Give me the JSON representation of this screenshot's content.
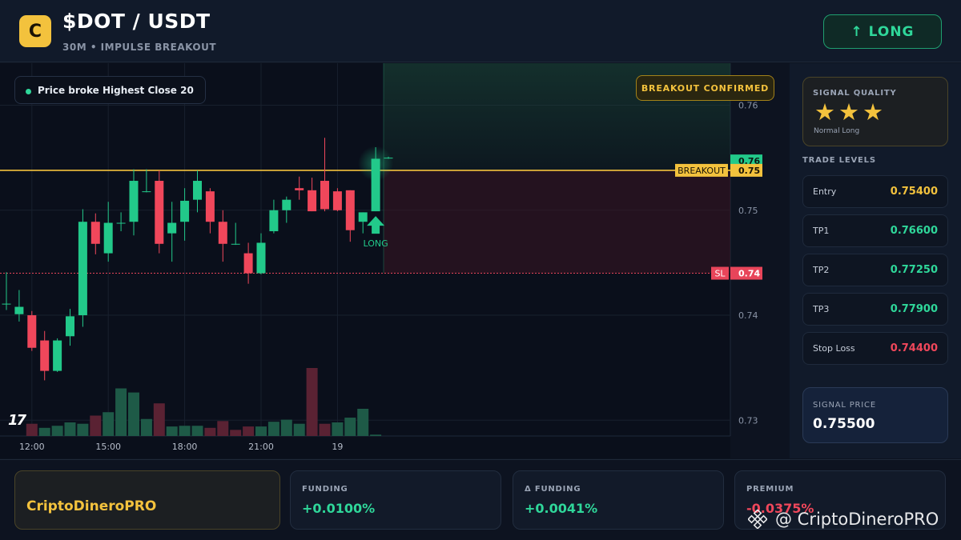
{
  "header": {
    "logo_letter": "C",
    "title": "$DOT / USDT",
    "subtitle": "30M • IMPULSE BREAKOUT",
    "action_label": "↑ LONG"
  },
  "chart": {
    "info_text": "Price broke Highest Close 20",
    "breakout_badge": "BREAKOUT CONFIRMED",
    "tv_logo": "17",
    "breakout_label": "BREAKOUT",
    "sl_label": "SL",
    "long_label": "LONG",
    "current_price_tag": "0.76",
    "breakout_price_tag": "0.75",
    "sl_price_tag": "0.74",
    "colors": {
      "up": "#22c98a",
      "down": "#f0475b",
      "breakout": "#f3c23d",
      "sl": "#e8455a",
      "volume_up": "#1e5a47",
      "volume_down": "#5a2233"
    }
  },
  "chart_data": {
    "type": "candlestick",
    "y_ticks": [
      "0.76",
      "0.75",
      "0.74",
      "0.73"
    ],
    "y_tick_values": [
      0.76,
      0.75,
      0.74,
      0.73
    ],
    "ylim": [
      0.7285,
      0.764
    ],
    "x_ticks": [
      "12:00",
      "15:00",
      "18:00",
      "21:00",
      "19"
    ],
    "x_tick_index": [
      2,
      8,
      14,
      20,
      26
    ],
    "breakout_level": 0.7538,
    "sl_level": 0.744,
    "candles": [
      {
        "o": 0.7411,
        "h": 0.7441,
        "l": 0.7405,
        "c": 0.7411
      },
      {
        "o": 0.7401,
        "h": 0.7424,
        "l": 0.7394,
        "c": 0.7408
      },
      {
        "o": 0.74,
        "h": 0.7404,
        "l": 0.7366,
        "c": 0.7369
      },
      {
        "o": 0.7376,
        "h": 0.7385,
        "l": 0.7338,
        "c": 0.7347
      },
      {
        "o": 0.7347,
        "h": 0.7378,
        "l": 0.7346,
        "c": 0.7376
      },
      {
        "o": 0.738,
        "h": 0.7406,
        "l": 0.7371,
        "c": 0.7399
      },
      {
        "o": 0.74,
        "h": 0.7501,
        "l": 0.7389,
        "c": 0.7489
      },
      {
        "o": 0.7489,
        "h": 0.7497,
        "l": 0.7458,
        "c": 0.7468
      },
      {
        "o": 0.7459,
        "h": 0.7508,
        "l": 0.7451,
        "c": 0.7488
      },
      {
        "o": 0.7488,
        "h": 0.7498,
        "l": 0.748,
        "c": 0.7488
      },
      {
        "o": 0.7489,
        "h": 0.7539,
        "l": 0.7476,
        "c": 0.7528
      },
      {
        "o": 0.7518,
        "h": 0.7539,
        "l": 0.7517,
        "c": 0.7518
      },
      {
        "o": 0.7528,
        "h": 0.7538,
        "l": 0.7459,
        "c": 0.7468
      },
      {
        "o": 0.7478,
        "h": 0.7508,
        "l": 0.7451,
        "c": 0.7488
      },
      {
        "o": 0.7489,
        "h": 0.7521,
        "l": 0.7471,
        "c": 0.7509
      },
      {
        "o": 0.751,
        "h": 0.7538,
        "l": 0.7498,
        "c": 0.7528
      },
      {
        "o": 0.7518,
        "h": 0.7521,
        "l": 0.7478,
        "c": 0.7489
      },
      {
        "o": 0.7489,
        "h": 0.75,
        "l": 0.7451,
        "c": 0.7468
      },
      {
        "o": 0.7468,
        "h": 0.7488,
        "l": 0.7467,
        "c": 0.7468
      },
      {
        "o": 0.7459,
        "h": 0.7469,
        "l": 0.743,
        "c": 0.744
      },
      {
        "o": 0.744,
        "h": 0.7478,
        "l": 0.7439,
        "c": 0.7469
      },
      {
        "o": 0.748,
        "h": 0.751,
        "l": 0.7478,
        "c": 0.75
      },
      {
        "o": 0.75,
        "h": 0.7513,
        "l": 0.7488,
        "c": 0.751
      },
      {
        "o": 0.7521,
        "h": 0.7532,
        "l": 0.751,
        "c": 0.7519
      },
      {
        "o": 0.7519,
        "h": 0.7531,
        "l": 0.75,
        "c": 0.7499
      },
      {
        "o": 0.7528,
        "h": 0.7569,
        "l": 0.7499,
        "c": 0.7501
      },
      {
        "o": 0.7518,
        "h": 0.7521,
        "l": 0.7499,
        "c": 0.75
      },
      {
        "o": 0.7519,
        "h": 0.7501,
        "l": 0.747,
        "c": 0.7481
      },
      {
        "o": 0.7489,
        "h": 0.7498,
        "l": 0.7478,
        "c": 0.7498
      },
      {
        "o": 0.7499,
        "h": 0.756,
        "l": 0.7499,
        "c": 0.7549
      },
      {
        "o": 0.755,
        "h": 0.7551,
        "l": 0.7549,
        "c": 0.755
      }
    ],
    "volumes": [
      {
        "v": 0,
        "up": true
      },
      {
        "v": 0,
        "up": true
      },
      {
        "v": 0.18,
        "up": false
      },
      {
        "v": 0.12,
        "up": true
      },
      {
        "v": 0.15,
        "up": true
      },
      {
        "v": 0.2,
        "up": true
      },
      {
        "v": 0.18,
        "up": true
      },
      {
        "v": 0.3,
        "up": false
      },
      {
        "v": 0.35,
        "up": true
      },
      {
        "v": 0.7,
        "up": true
      },
      {
        "v": 0.64,
        "up": true
      },
      {
        "v": 0.25,
        "up": true
      },
      {
        "v": 0.48,
        "up": false
      },
      {
        "v": 0.14,
        "up": true
      },
      {
        "v": 0.15,
        "up": true
      },
      {
        "v": 0.15,
        "up": true
      },
      {
        "v": 0.12,
        "up": false
      },
      {
        "v": 0.22,
        "up": false
      },
      {
        "v": 0.09,
        "up": false
      },
      {
        "v": 0.14,
        "up": false
      },
      {
        "v": 0.14,
        "up": true
      },
      {
        "v": 0.21,
        "up": true
      },
      {
        "v": 0.24,
        "up": true
      },
      {
        "v": 0.18,
        "up": true
      },
      {
        "v": 1.0,
        "up": false
      },
      {
        "v": 0.18,
        "up": false
      },
      {
        "v": 0.2,
        "up": true
      },
      {
        "v": 0.27,
        "up": true
      },
      {
        "v": 0.4,
        "up": true
      },
      {
        "v": 0.02,
        "up": true
      }
    ]
  },
  "sidebar": {
    "quality_label": "SIGNAL QUALITY",
    "stars": "★★★",
    "quality_desc": "Normal Long",
    "levels_title": "TRADE LEVELS",
    "levels": [
      {
        "name": "Entry",
        "value": "0.75400",
        "color": "#f3c23d"
      },
      {
        "name": "TP1",
        "value": "0.76600",
        "color": "#2fd79a"
      },
      {
        "name": "TP2",
        "value": "0.77250",
        "color": "#2fd79a"
      },
      {
        "name": "TP3",
        "value": "0.77900",
        "color": "#2fd79a"
      },
      {
        "name": "Stop Loss",
        "value": "0.74400",
        "color": "#f0475b"
      }
    ],
    "signal_label": "SIGNAL PRICE",
    "signal_value": "0.75500"
  },
  "footer": {
    "brand": "CriptoDineroPRO",
    "funding_label": "FUNDING",
    "funding_value": "+0.0100%",
    "dfunding_label": "Δ FUNDING",
    "dfunding_value": "+0.0041%",
    "premium_label": "PREMIUM",
    "premium_value": "-0.0375%"
  },
  "watermark": {
    "text": "@ CriptoDineroPRO"
  }
}
